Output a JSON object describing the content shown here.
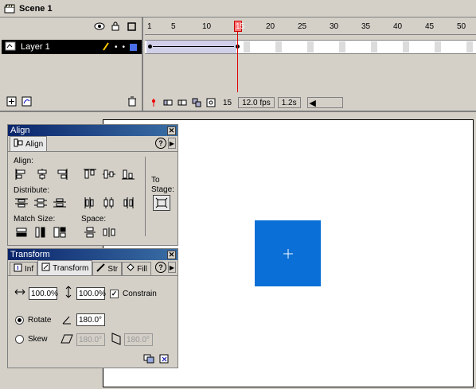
{
  "scene": {
    "label": "Scene 1"
  },
  "timeline": {
    "layer_name": "Layer 1",
    "ruler_marks": [
      "1",
      "5",
      "10",
      "15",
      "20",
      "25",
      "30",
      "35",
      "40",
      "45",
      "50"
    ],
    "current_frame": "15",
    "fps": "12.0 fps",
    "elapsed": "1.2s"
  },
  "align_panel": {
    "title": "Align",
    "tab_label": "Align",
    "align_label": "Align:",
    "distribute_label": "Distribute:",
    "match_size_label": "Match Size:",
    "space_label": "Space:",
    "to_stage_label": "To Stage:"
  },
  "transform_panel": {
    "title": "Transform",
    "tabs": [
      "Inf",
      "Transform",
      "Str",
      "Fill"
    ],
    "width_value": "100.0%",
    "height_value": "100.0%",
    "constrain_label": "Constrain",
    "rotate_label": "Rotate",
    "rotate_value": "180.0°",
    "skew_label": "Skew",
    "skew_h_value": "180.0°",
    "skew_v_value": "180.0°"
  },
  "colors": {
    "shape_fill": "#0a6fd6",
    "playhead": "#e00000",
    "title_bar": "#0a246a"
  }
}
